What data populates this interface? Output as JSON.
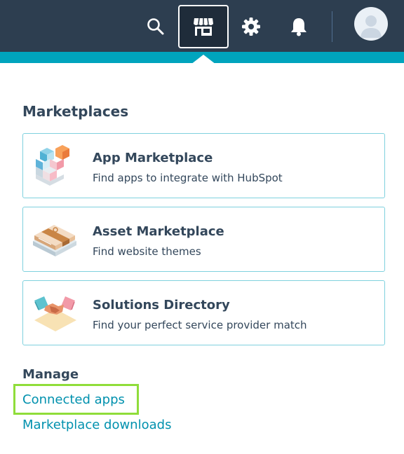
{
  "topbar": {
    "icons": {
      "search": "search-icon",
      "marketplace": "marketplace-icon",
      "settings": "gear-icon",
      "notifications": "bell-icon",
      "avatar": "user-avatar"
    }
  },
  "marketplaces": {
    "title": "Marketplaces",
    "cards": [
      {
        "title": "App Marketplace",
        "description": "Find apps to integrate with HubSpot",
        "icon": "app-blocks-icon"
      },
      {
        "title": "Asset Marketplace",
        "description": "Find website themes",
        "icon": "asset-package-icon"
      },
      {
        "title": "Solutions Directory",
        "description": "Find your perfect service provider match",
        "icon": "handshake-icon"
      }
    ]
  },
  "manage": {
    "title": "Manage",
    "links": [
      {
        "label": "Connected apps"
      },
      {
        "label": "Marketplace downloads"
      }
    ]
  },
  "colors": {
    "topbar": "#2d3e50",
    "accent": "#00a4bd",
    "link": "#0091ae",
    "card_border": "#7fd1de",
    "highlight": "#8fdd3a"
  }
}
